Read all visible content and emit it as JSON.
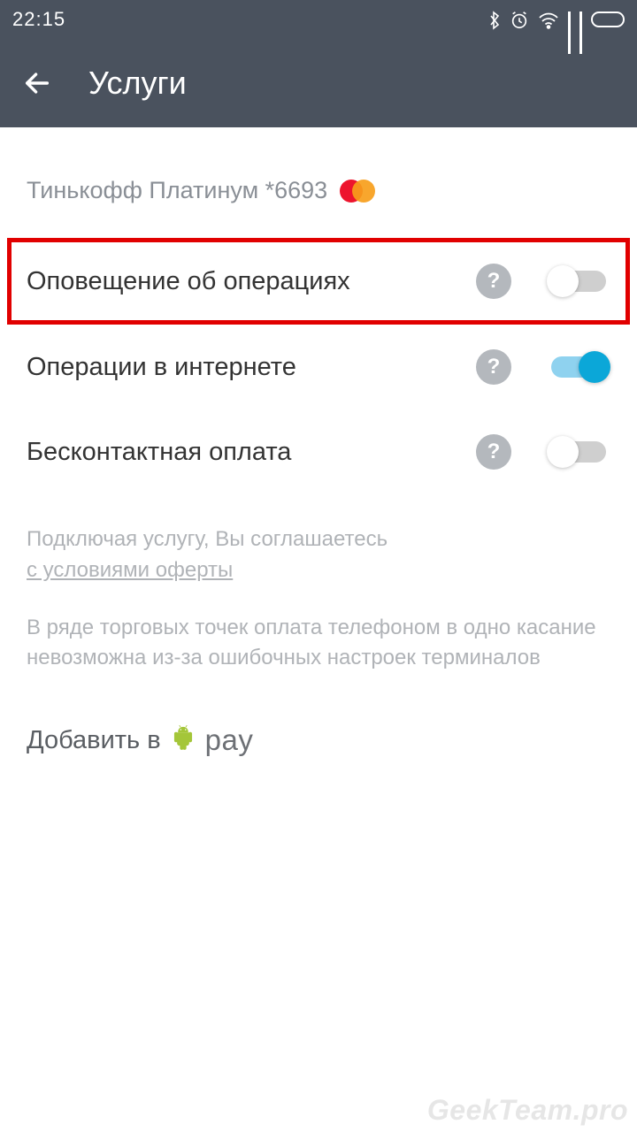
{
  "statusbar": {
    "time": "22:15"
  },
  "appbar": {
    "title": "Услуги"
  },
  "card": {
    "name": "Тинькофф Платинум *6693"
  },
  "rows": [
    {
      "label": "Оповещение об операциях",
      "on": false,
      "highlight": true
    },
    {
      "label": "Операции в интернете",
      "on": true,
      "highlight": false
    },
    {
      "label": "Бесконтактная оплата",
      "on": false,
      "highlight": false
    }
  ],
  "disclosure": {
    "line1": "Подключая услугу, Вы соглашаетесь",
    "link": "с условиями оферты",
    "para2": "В ряде торговых точек оплата телефоном в одно касание невозможна из-за ошибочных настроек терминалов"
  },
  "addpay": {
    "prefix": "Добавить в",
    "brand": "pay"
  },
  "watermark": "GeekTeam.pro"
}
